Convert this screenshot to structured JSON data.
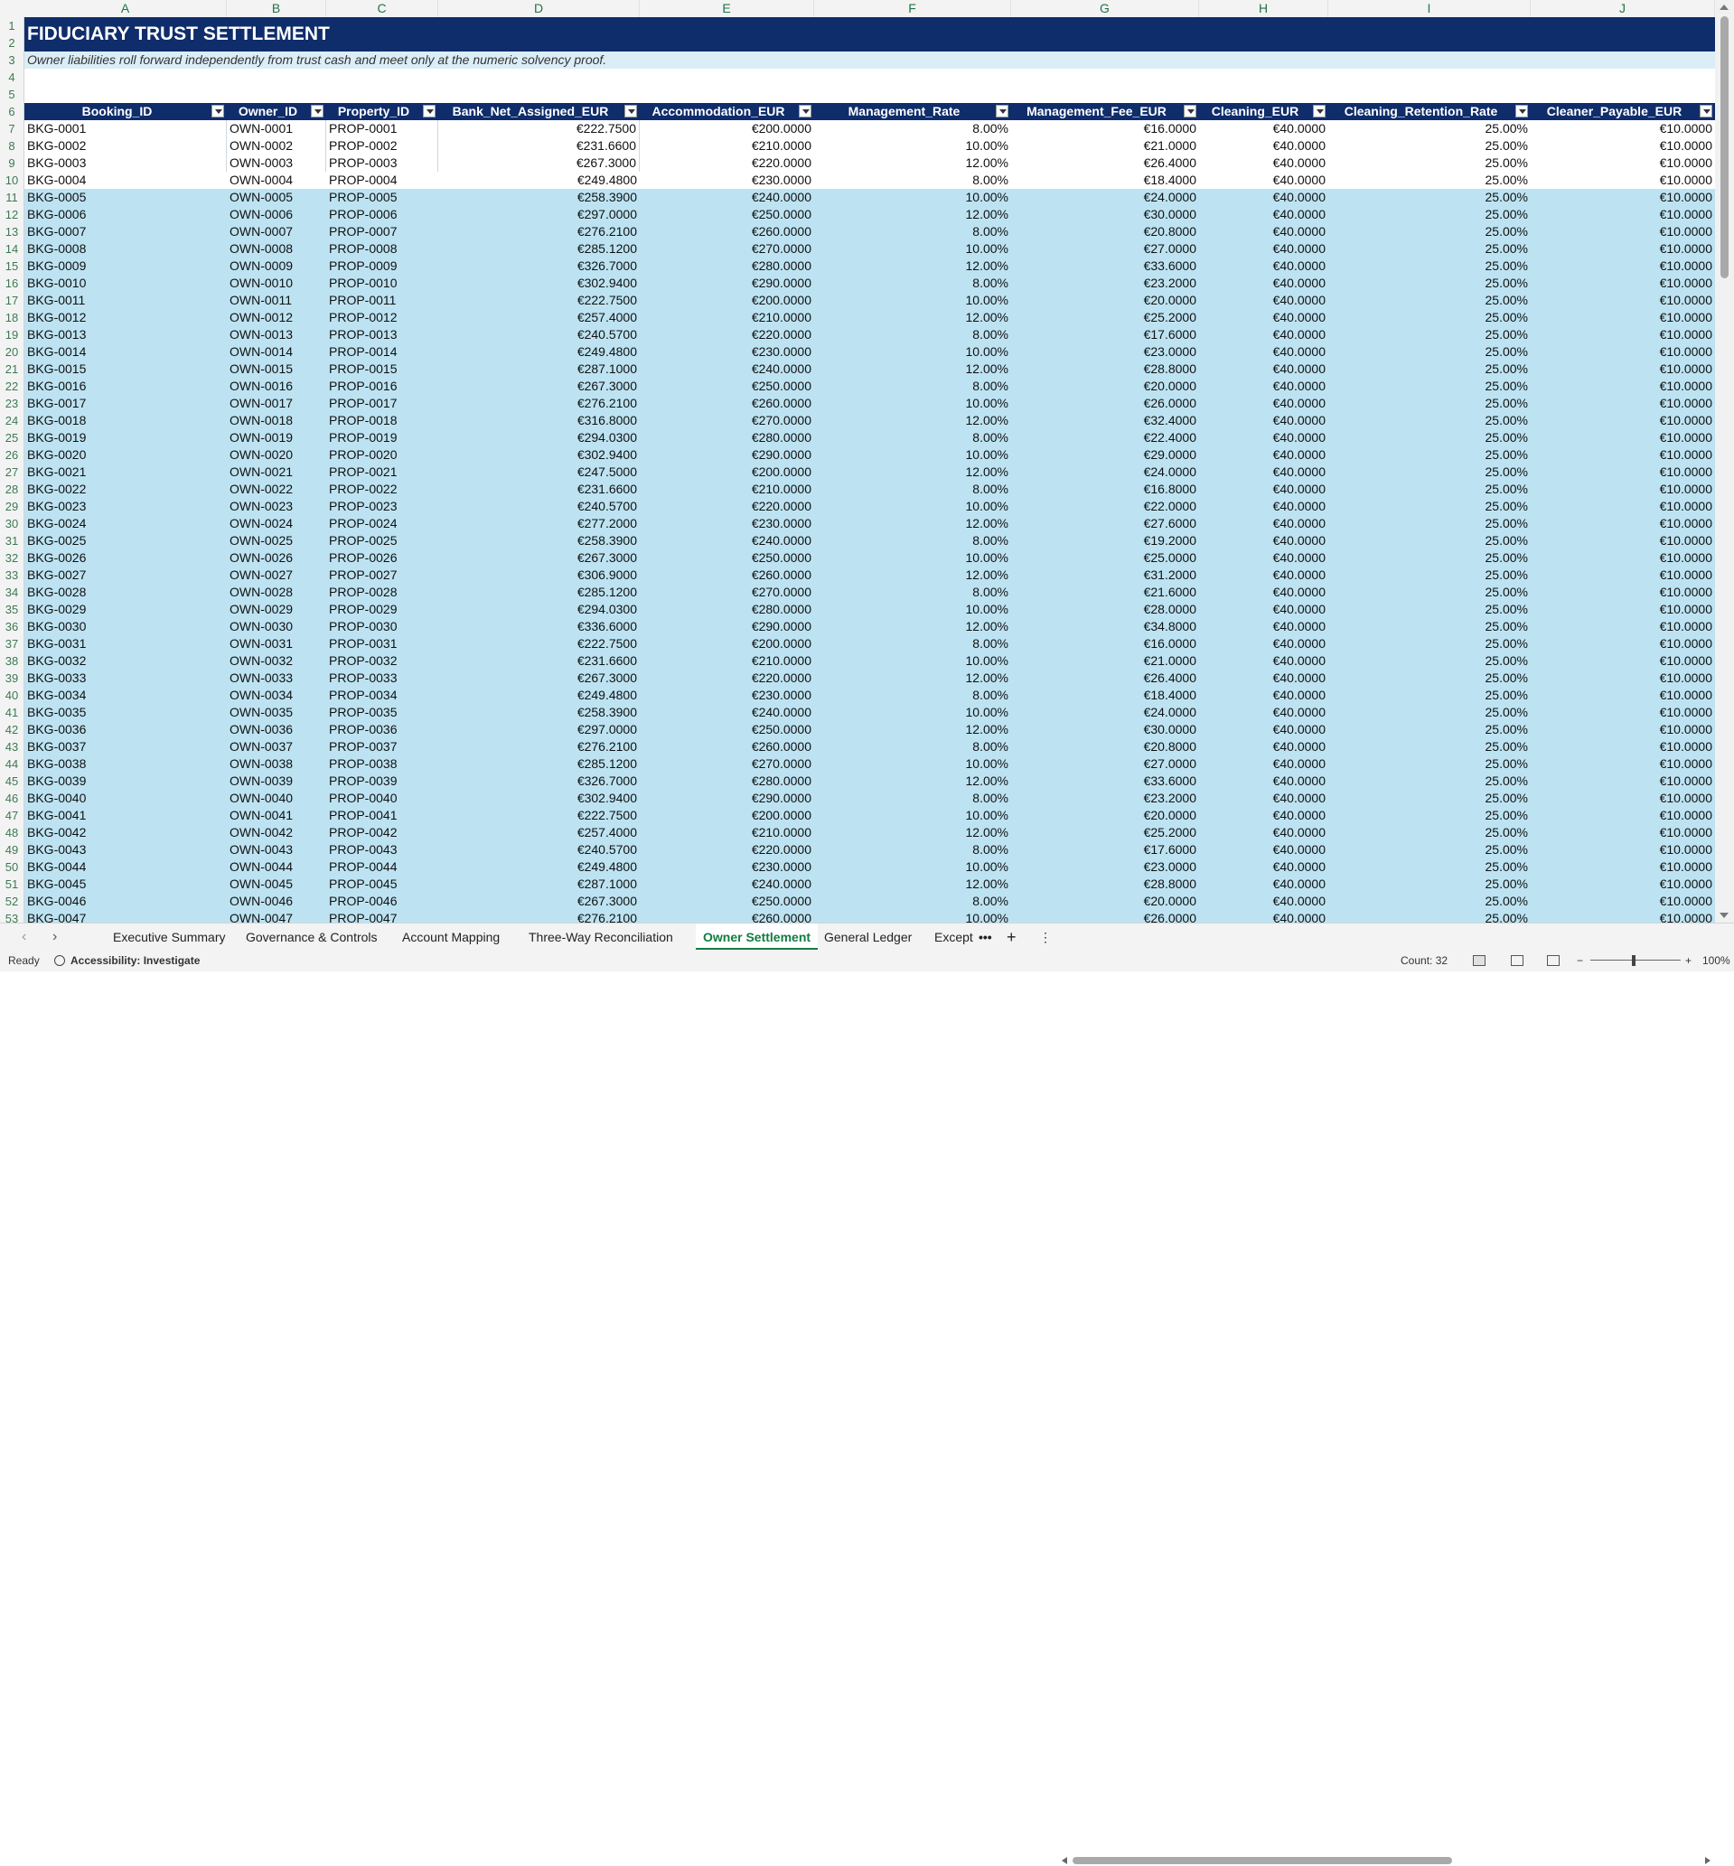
{
  "columns": [
    "A",
    "B",
    "C",
    "D",
    "E",
    "F",
    "G",
    "H",
    "I",
    "J"
  ],
  "title": "FIDUCIARY TRUST SETTLEMENT",
  "subtitle": "Owner liabilities roll forward independently from trust cash and meet only at the numeric solvency proof.",
  "headers": [
    "Booking_ID",
    "Owner_ID",
    "Property_ID",
    "Bank_Net_Assigned_EUR",
    "Accommodation_EUR",
    "Management_Rate",
    "Management_Fee_EUR",
    "Cleaning_EUR",
    "Cleaning_Retention_Rate",
    "Cleaner_Payable_EUR"
  ],
  "row_numbers": [
    "1",
    "2",
    "3",
    "4",
    "5",
    "6",
    "7",
    "8",
    "9",
    "10",
    "11",
    "12",
    "13",
    "14",
    "15",
    "16",
    "17",
    "18",
    "19",
    "20",
    "21",
    "22",
    "23",
    "24",
    "25",
    "26",
    "27",
    "28",
    "29",
    "30",
    "31",
    "32",
    "33",
    "34",
    "35",
    "36",
    "37",
    "38",
    "39",
    "40",
    "41",
    "42",
    "43",
    "44",
    "45",
    "46",
    "47",
    "48",
    "49",
    "50",
    "51",
    "52",
    "53"
  ],
  "rows": [
    [
      "BKG-0001",
      "OWN-0001",
      "PROP-0001",
      "€222.7500",
      "€200.0000",
      "8.00%",
      "€16.0000",
      "€40.0000",
      "25.00%",
      "€10.0000"
    ],
    [
      "BKG-0002",
      "OWN-0002",
      "PROP-0002",
      "€231.6600",
      "€210.0000",
      "10.00%",
      "€21.0000",
      "€40.0000",
      "25.00%",
      "€10.0000"
    ],
    [
      "BKG-0003",
      "OWN-0003",
      "PROP-0003",
      "€267.3000",
      "€220.0000",
      "12.00%",
      "€26.4000",
      "€40.0000",
      "25.00%",
      "€10.0000"
    ],
    [
      "BKG-0004",
      "OWN-0004",
      "PROP-0004",
      "€249.4800",
      "€230.0000",
      "8.00%",
      "€18.4000",
      "€40.0000",
      "25.00%",
      "€10.0000"
    ],
    [
      "BKG-0005",
      "OWN-0005",
      "PROP-0005",
      "€258.3900",
      "€240.0000",
      "10.00%",
      "€24.0000",
      "€40.0000",
      "25.00%",
      "€10.0000"
    ],
    [
      "BKG-0006",
      "OWN-0006",
      "PROP-0006",
      "€297.0000",
      "€250.0000",
      "12.00%",
      "€30.0000",
      "€40.0000",
      "25.00%",
      "€10.0000"
    ],
    [
      "BKG-0007",
      "OWN-0007",
      "PROP-0007",
      "€276.2100",
      "€260.0000",
      "8.00%",
      "€20.8000",
      "€40.0000",
      "25.00%",
      "€10.0000"
    ],
    [
      "BKG-0008",
      "OWN-0008",
      "PROP-0008",
      "€285.1200",
      "€270.0000",
      "10.00%",
      "€27.0000",
      "€40.0000",
      "25.00%",
      "€10.0000"
    ],
    [
      "BKG-0009",
      "OWN-0009",
      "PROP-0009",
      "€326.7000",
      "€280.0000",
      "12.00%",
      "€33.6000",
      "€40.0000",
      "25.00%",
      "€10.0000"
    ],
    [
      "BKG-0010",
      "OWN-0010",
      "PROP-0010",
      "€302.9400",
      "€290.0000",
      "8.00%",
      "€23.2000",
      "€40.0000",
      "25.00%",
      "€10.0000"
    ],
    [
      "BKG-0011",
      "OWN-0011",
      "PROP-0011",
      "€222.7500",
      "€200.0000",
      "10.00%",
      "€20.0000",
      "€40.0000",
      "25.00%",
      "€10.0000"
    ],
    [
      "BKG-0012",
      "OWN-0012",
      "PROP-0012",
      "€257.4000",
      "€210.0000",
      "12.00%",
      "€25.2000",
      "€40.0000",
      "25.00%",
      "€10.0000"
    ],
    [
      "BKG-0013",
      "OWN-0013",
      "PROP-0013",
      "€240.5700",
      "€220.0000",
      "8.00%",
      "€17.6000",
      "€40.0000",
      "25.00%",
      "€10.0000"
    ],
    [
      "BKG-0014",
      "OWN-0014",
      "PROP-0014",
      "€249.4800",
      "€230.0000",
      "10.00%",
      "€23.0000",
      "€40.0000",
      "25.00%",
      "€10.0000"
    ],
    [
      "BKG-0015",
      "OWN-0015",
      "PROP-0015",
      "€287.1000",
      "€240.0000",
      "12.00%",
      "€28.8000",
      "€40.0000",
      "25.00%",
      "€10.0000"
    ],
    [
      "BKG-0016",
      "OWN-0016",
      "PROP-0016",
      "€267.3000",
      "€250.0000",
      "8.00%",
      "€20.0000",
      "€40.0000",
      "25.00%",
      "€10.0000"
    ],
    [
      "BKG-0017",
      "OWN-0017",
      "PROP-0017",
      "€276.2100",
      "€260.0000",
      "10.00%",
      "€26.0000",
      "€40.0000",
      "25.00%",
      "€10.0000"
    ],
    [
      "BKG-0018",
      "OWN-0018",
      "PROP-0018",
      "€316.8000",
      "€270.0000",
      "12.00%",
      "€32.4000",
      "€40.0000",
      "25.00%",
      "€10.0000"
    ],
    [
      "BKG-0019",
      "OWN-0019",
      "PROP-0019",
      "€294.0300",
      "€280.0000",
      "8.00%",
      "€22.4000",
      "€40.0000",
      "25.00%",
      "€10.0000"
    ],
    [
      "BKG-0020",
      "OWN-0020",
      "PROP-0020",
      "€302.9400",
      "€290.0000",
      "10.00%",
      "€29.0000",
      "€40.0000",
      "25.00%",
      "€10.0000"
    ],
    [
      "BKG-0021",
      "OWN-0021",
      "PROP-0021",
      "€247.5000",
      "€200.0000",
      "12.00%",
      "€24.0000",
      "€40.0000",
      "25.00%",
      "€10.0000"
    ],
    [
      "BKG-0022",
      "OWN-0022",
      "PROP-0022",
      "€231.6600",
      "€210.0000",
      "8.00%",
      "€16.8000",
      "€40.0000",
      "25.00%",
      "€10.0000"
    ],
    [
      "BKG-0023",
      "OWN-0023",
      "PROP-0023",
      "€240.5700",
      "€220.0000",
      "10.00%",
      "€22.0000",
      "€40.0000",
      "25.00%",
      "€10.0000"
    ],
    [
      "BKG-0024",
      "OWN-0024",
      "PROP-0024",
      "€277.2000",
      "€230.0000",
      "12.00%",
      "€27.6000",
      "€40.0000",
      "25.00%",
      "€10.0000"
    ],
    [
      "BKG-0025",
      "OWN-0025",
      "PROP-0025",
      "€258.3900",
      "€240.0000",
      "8.00%",
      "€19.2000",
      "€40.0000",
      "25.00%",
      "€10.0000"
    ],
    [
      "BKG-0026",
      "OWN-0026",
      "PROP-0026",
      "€267.3000",
      "€250.0000",
      "10.00%",
      "€25.0000",
      "€40.0000",
      "25.00%",
      "€10.0000"
    ],
    [
      "BKG-0027",
      "OWN-0027",
      "PROP-0027",
      "€306.9000",
      "€260.0000",
      "12.00%",
      "€31.2000",
      "€40.0000",
      "25.00%",
      "€10.0000"
    ],
    [
      "BKG-0028",
      "OWN-0028",
      "PROP-0028",
      "€285.1200",
      "€270.0000",
      "8.00%",
      "€21.6000",
      "€40.0000",
      "25.00%",
      "€10.0000"
    ],
    [
      "BKG-0029",
      "OWN-0029",
      "PROP-0029",
      "€294.0300",
      "€280.0000",
      "10.00%",
      "€28.0000",
      "€40.0000",
      "25.00%",
      "€10.0000"
    ],
    [
      "BKG-0030",
      "OWN-0030",
      "PROP-0030",
      "€336.6000",
      "€290.0000",
      "12.00%",
      "€34.8000",
      "€40.0000",
      "25.00%",
      "€10.0000"
    ],
    [
      "BKG-0031",
      "OWN-0031",
      "PROP-0031",
      "€222.7500",
      "€200.0000",
      "8.00%",
      "€16.0000",
      "€40.0000",
      "25.00%",
      "€10.0000"
    ],
    [
      "BKG-0032",
      "OWN-0032",
      "PROP-0032",
      "€231.6600",
      "€210.0000",
      "10.00%",
      "€21.0000",
      "€40.0000",
      "25.00%",
      "€10.0000"
    ],
    [
      "BKG-0033",
      "OWN-0033",
      "PROP-0033",
      "€267.3000",
      "€220.0000",
      "12.00%",
      "€26.4000",
      "€40.0000",
      "25.00%",
      "€10.0000"
    ],
    [
      "BKG-0034",
      "OWN-0034",
      "PROP-0034",
      "€249.4800",
      "€230.0000",
      "8.00%",
      "€18.4000",
      "€40.0000",
      "25.00%",
      "€10.0000"
    ],
    [
      "BKG-0035",
      "OWN-0035",
      "PROP-0035",
      "€258.3900",
      "€240.0000",
      "10.00%",
      "€24.0000",
      "€40.0000",
      "25.00%",
      "€10.0000"
    ],
    [
      "BKG-0036",
      "OWN-0036",
      "PROP-0036",
      "€297.0000",
      "€250.0000",
      "12.00%",
      "€30.0000",
      "€40.0000",
      "25.00%",
      "€10.0000"
    ],
    [
      "BKG-0037",
      "OWN-0037",
      "PROP-0037",
      "€276.2100",
      "€260.0000",
      "8.00%",
      "€20.8000",
      "€40.0000",
      "25.00%",
      "€10.0000"
    ],
    [
      "BKG-0038",
      "OWN-0038",
      "PROP-0038",
      "€285.1200",
      "€270.0000",
      "10.00%",
      "€27.0000",
      "€40.0000",
      "25.00%",
      "€10.0000"
    ],
    [
      "BKG-0039",
      "OWN-0039",
      "PROP-0039",
      "€326.7000",
      "€280.0000",
      "12.00%",
      "€33.6000",
      "€40.0000",
      "25.00%",
      "€10.0000"
    ],
    [
      "BKG-0040",
      "OWN-0040",
      "PROP-0040",
      "€302.9400",
      "€290.0000",
      "8.00%",
      "€23.2000",
      "€40.0000",
      "25.00%",
      "€10.0000"
    ],
    [
      "BKG-0041",
      "OWN-0041",
      "PROP-0041",
      "€222.7500",
      "€200.0000",
      "10.00%",
      "€20.0000",
      "€40.0000",
      "25.00%",
      "€10.0000"
    ],
    [
      "BKG-0042",
      "OWN-0042",
      "PROP-0042",
      "€257.4000",
      "€210.0000",
      "12.00%",
      "€25.2000",
      "€40.0000",
      "25.00%",
      "€10.0000"
    ],
    [
      "BKG-0043",
      "OWN-0043",
      "PROP-0043",
      "€240.5700",
      "€220.0000",
      "8.00%",
      "€17.6000",
      "€40.0000",
      "25.00%",
      "€10.0000"
    ],
    [
      "BKG-0044",
      "OWN-0044",
      "PROP-0044",
      "€249.4800",
      "€230.0000",
      "10.00%",
      "€23.0000",
      "€40.0000",
      "25.00%",
      "€10.0000"
    ],
    [
      "BKG-0045",
      "OWN-0045",
      "PROP-0045",
      "€287.1000",
      "€240.0000",
      "12.00%",
      "€28.8000",
      "€40.0000",
      "25.00%",
      "€10.0000"
    ],
    [
      "BKG-0046",
      "OWN-0046",
      "PROP-0046",
      "€267.3000",
      "€250.0000",
      "8.00%",
      "€20.0000",
      "€40.0000",
      "25.00%",
      "€10.0000"
    ],
    [
      "BKG-0047",
      "OWN-0047",
      "PROP-0047",
      "€276.2100",
      "€260.0000",
      "10.00%",
      "€26.0000",
      "€40.0000",
      "25.00%",
      "€10.0000"
    ]
  ],
  "tabs": [
    "Executive Summary",
    "Governance & Controls",
    "Account Mapping",
    "Three-Way Reconciliation",
    "Owner Settlement",
    "General Ledger",
    "Except"
  ],
  "active_tab": "Owner Settlement",
  "tab_more": "•••",
  "add_sheet": "+",
  "sheet_menu": "⋮",
  "status": {
    "ready": "Ready",
    "accessibility": "Accessibility: Investigate",
    "count": "Count: 32",
    "zoom": "100%"
  },
  "colors": {
    "header_bg": "#0f2d6b",
    "band": "#bde3f2",
    "accent": "#107c41"
  }
}
